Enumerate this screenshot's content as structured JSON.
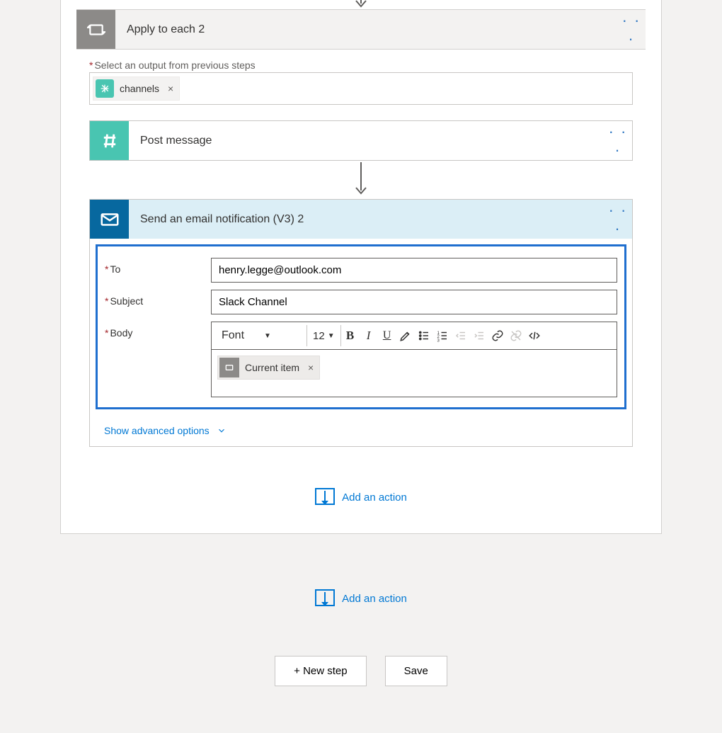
{
  "apply_to_each": {
    "title": "Apply to each 2",
    "select_output_label": "Select an output from previous steps",
    "output_chip": "channels"
  },
  "post_message": {
    "title": "Post message"
  },
  "send_email": {
    "title": "Send an email notification (V3) 2",
    "fields": {
      "to_label": "To",
      "to_value": "henry.legge@outlook.com",
      "subject_label": "Subject",
      "subject_value": "Slack Channel",
      "body_label": "Body",
      "font_label": "Font",
      "font_size": "12",
      "body_chip": "Current item"
    },
    "advanced_link": "Show advanced options"
  },
  "add_action_label": "Add an action",
  "footer": {
    "new_step": "+ New step",
    "save": "Save"
  }
}
